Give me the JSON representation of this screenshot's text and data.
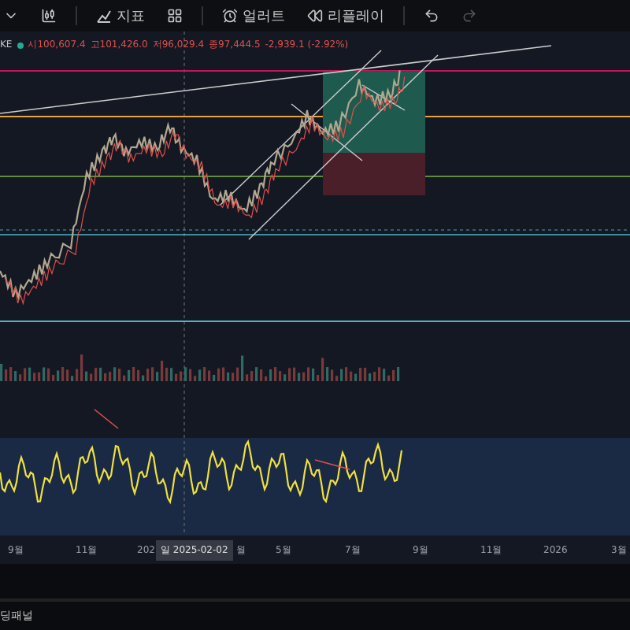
{
  "toolbar": {
    "items": [
      {
        "kind": "caret"
      },
      {
        "kind": "candles"
      },
      {
        "kind": "indicators",
        "label": "지표"
      },
      {
        "kind": "layout"
      },
      {
        "kind": "alert",
        "label": "얼러트"
      },
      {
        "kind": "replay",
        "label": "리플레이"
      },
      {
        "kind": "undo"
      },
      {
        "kind": "redo",
        "disabled": true
      }
    ]
  },
  "legend": {
    "symbol": "KE",
    "open": "시100,607.4",
    "high": "고101,426.0",
    "low": "저96,029.4",
    "close": "종97,444.5",
    "change": "-2,939.1 (-2.92%)"
  },
  "time_axis": {
    "labels": [
      "9월",
      "11월",
      "202"
    ],
    "crosshair_label": "일 2025-02-02",
    "labels_after": [
      "월",
      "5월",
      "7월",
      "9월",
      "11월",
      "2026",
      "3월"
    ]
  },
  "bottom_panel": {
    "title": "딩패널"
  }
}
